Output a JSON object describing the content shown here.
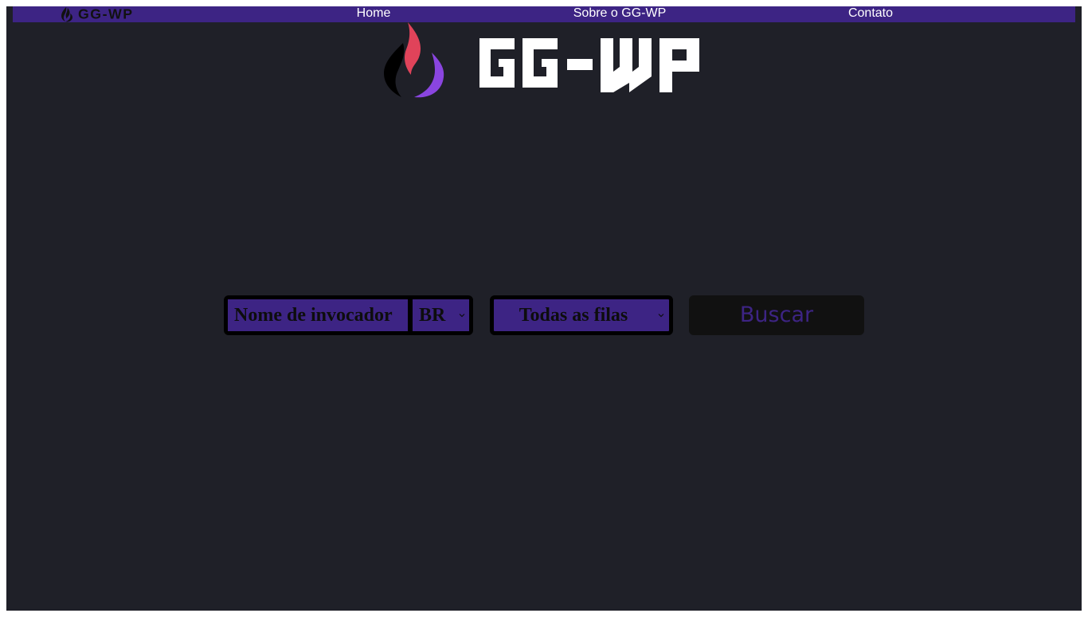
{
  "brand": {
    "name": "GG-WP",
    "colors": {
      "nav_background": "#3d2484",
      "page_background": "#1f2028",
      "flame_red": "#e0435a",
      "flame_purple": "#8a45e0",
      "flame_black": "#000000"
    }
  },
  "nav": {
    "logo_icon": "flame-logo-icon",
    "links": [
      {
        "label": "Home"
      },
      {
        "label": "Sobre o GG-WP"
      },
      {
        "label": "Contato"
      }
    ]
  },
  "hero": {
    "logo_icon": "flame-logo-icon",
    "wordmark": "GG-WP"
  },
  "search": {
    "summoner_placeholder": "Nome de invocador",
    "summoner_value": "",
    "region_selected": "BR",
    "queue_selected": "Todas as filas",
    "submit_label": "Buscar",
    "chevron_icon": "chevron-down-icon"
  }
}
